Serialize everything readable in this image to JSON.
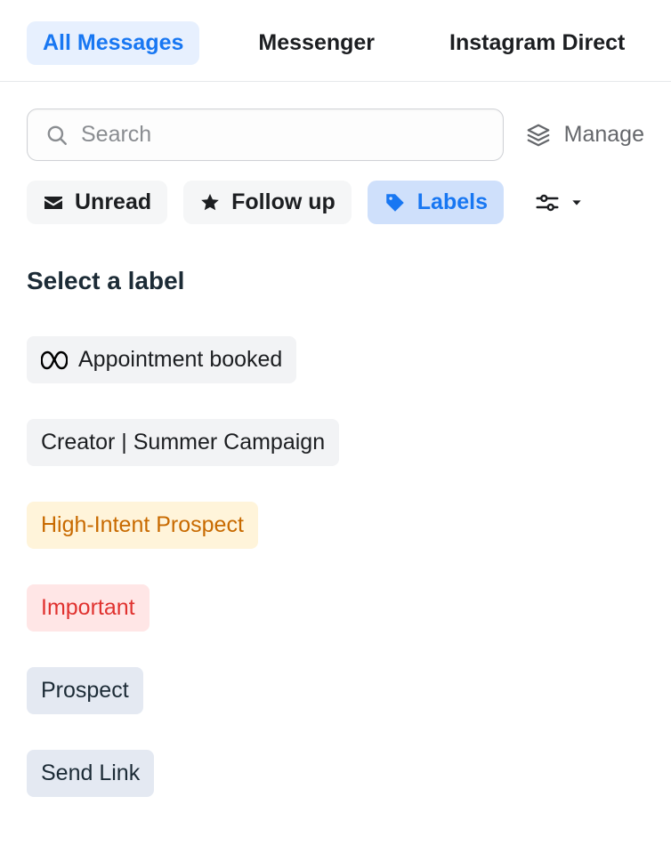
{
  "tabs": {
    "all_messages": "All Messages",
    "messenger": "Messenger",
    "instagram": "Instagram Direct"
  },
  "search": {
    "placeholder": "Search"
  },
  "manage": {
    "label": "Manage"
  },
  "filters": {
    "unread": "Unread",
    "follow_up": "Follow up",
    "labels": "Labels"
  },
  "section_title": "Select a label",
  "labels": {
    "0": "Appointment booked",
    "1": "Creator | Summer Campaign",
    "2": "High-Intent Prospect",
    "3": "Important",
    "4": "Prospect",
    "5": "Send Link"
  }
}
